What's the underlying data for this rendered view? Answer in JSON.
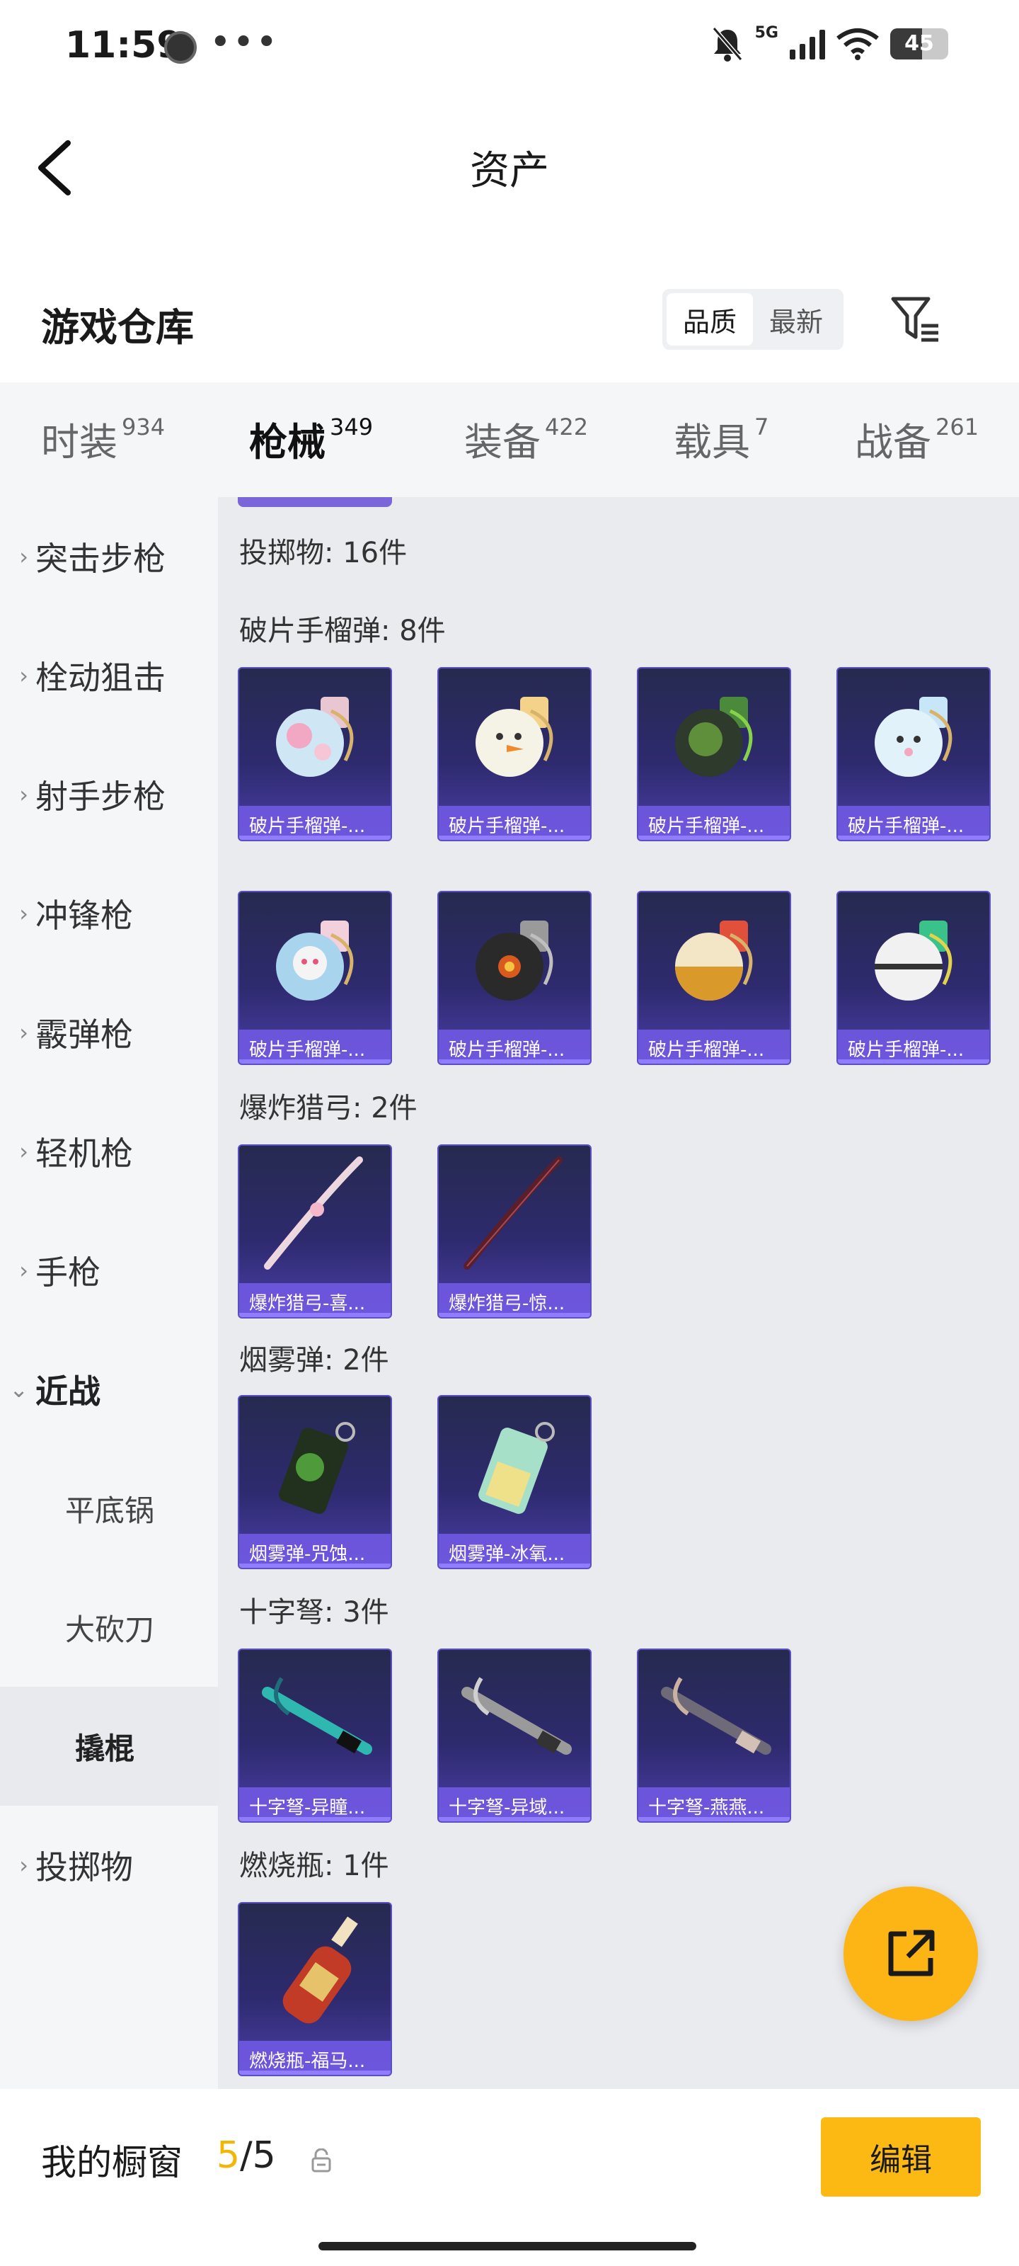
{
  "status_bar": {
    "time": "11:59",
    "dots": "•••",
    "network": "5G",
    "battery": "45"
  },
  "header": {
    "title": "资产"
  },
  "warehouse": {
    "title": "游戏仓库",
    "sort_options": [
      "品质",
      "最新"
    ],
    "active_sort": "品质"
  },
  "categories": [
    {
      "label": "时装",
      "count": "934"
    },
    {
      "label": "枪械",
      "count": "349",
      "active": true
    },
    {
      "label": "装备",
      "count": "422"
    },
    {
      "label": "载具",
      "count": "7"
    },
    {
      "label": "战备",
      "count": "261"
    }
  ],
  "sidebar": {
    "items": [
      {
        "label": "突击步枪",
        "chevron": "›"
      },
      {
        "label": "栓动狙击",
        "chevron": "›"
      },
      {
        "label": "射手步枪",
        "chevron": "›"
      },
      {
        "label": "冲锋枪",
        "chevron": "›"
      },
      {
        "label": "霰弹枪",
        "chevron": "›"
      },
      {
        "label": "轻机枪",
        "chevron": "›"
      },
      {
        "label": "手枪",
        "chevron": "›"
      },
      {
        "label": "近战",
        "chevron": "⌄"
      },
      {
        "label": "平底锅"
      },
      {
        "label": "大砍刀"
      },
      {
        "label": "撬棍"
      },
      {
        "label": "投掷物",
        "chevron": "›"
      }
    ]
  },
  "content": {
    "section_title": "投掷物: 16件",
    "groups": [
      {
        "title": "破片手榴弹: 8件",
        "items": [
          "破片手榴弹-...",
          "破片手榴弹-...",
          "破片手榴弹-...",
          "破片手榴弹-...",
          "破片手榴弹-...",
          "破片手榴弹-...",
          "破片手榴弹-...",
          "破片手榴弹-..."
        ]
      },
      {
        "title": "爆炸猎弓: 2件",
        "items": [
          "爆炸猎弓-喜...",
          "爆炸猎弓-惊..."
        ]
      },
      {
        "title": "烟雾弹: 2件",
        "items": [
          "烟雾弹-咒蚀...",
          "烟雾弹-冰氧..."
        ]
      },
      {
        "title": "十字弩: 3件",
        "items": [
          "十字弩-异瞳...",
          "十字弩-异域...",
          "十字弩-燕燕..."
        ]
      },
      {
        "title": "燃烧瓶: 1件",
        "items": [
          "燃烧瓶-福马..."
        ]
      }
    ]
  },
  "bottom_bar": {
    "label": "我的橱窗",
    "current": "5",
    "total": "/5",
    "edit_label": "编辑"
  },
  "colors": {
    "accent": "#f2b705",
    "card_top": "#262a4f",
    "card_bottom": "#4a3fa8",
    "fab": "#fdb515"
  }
}
